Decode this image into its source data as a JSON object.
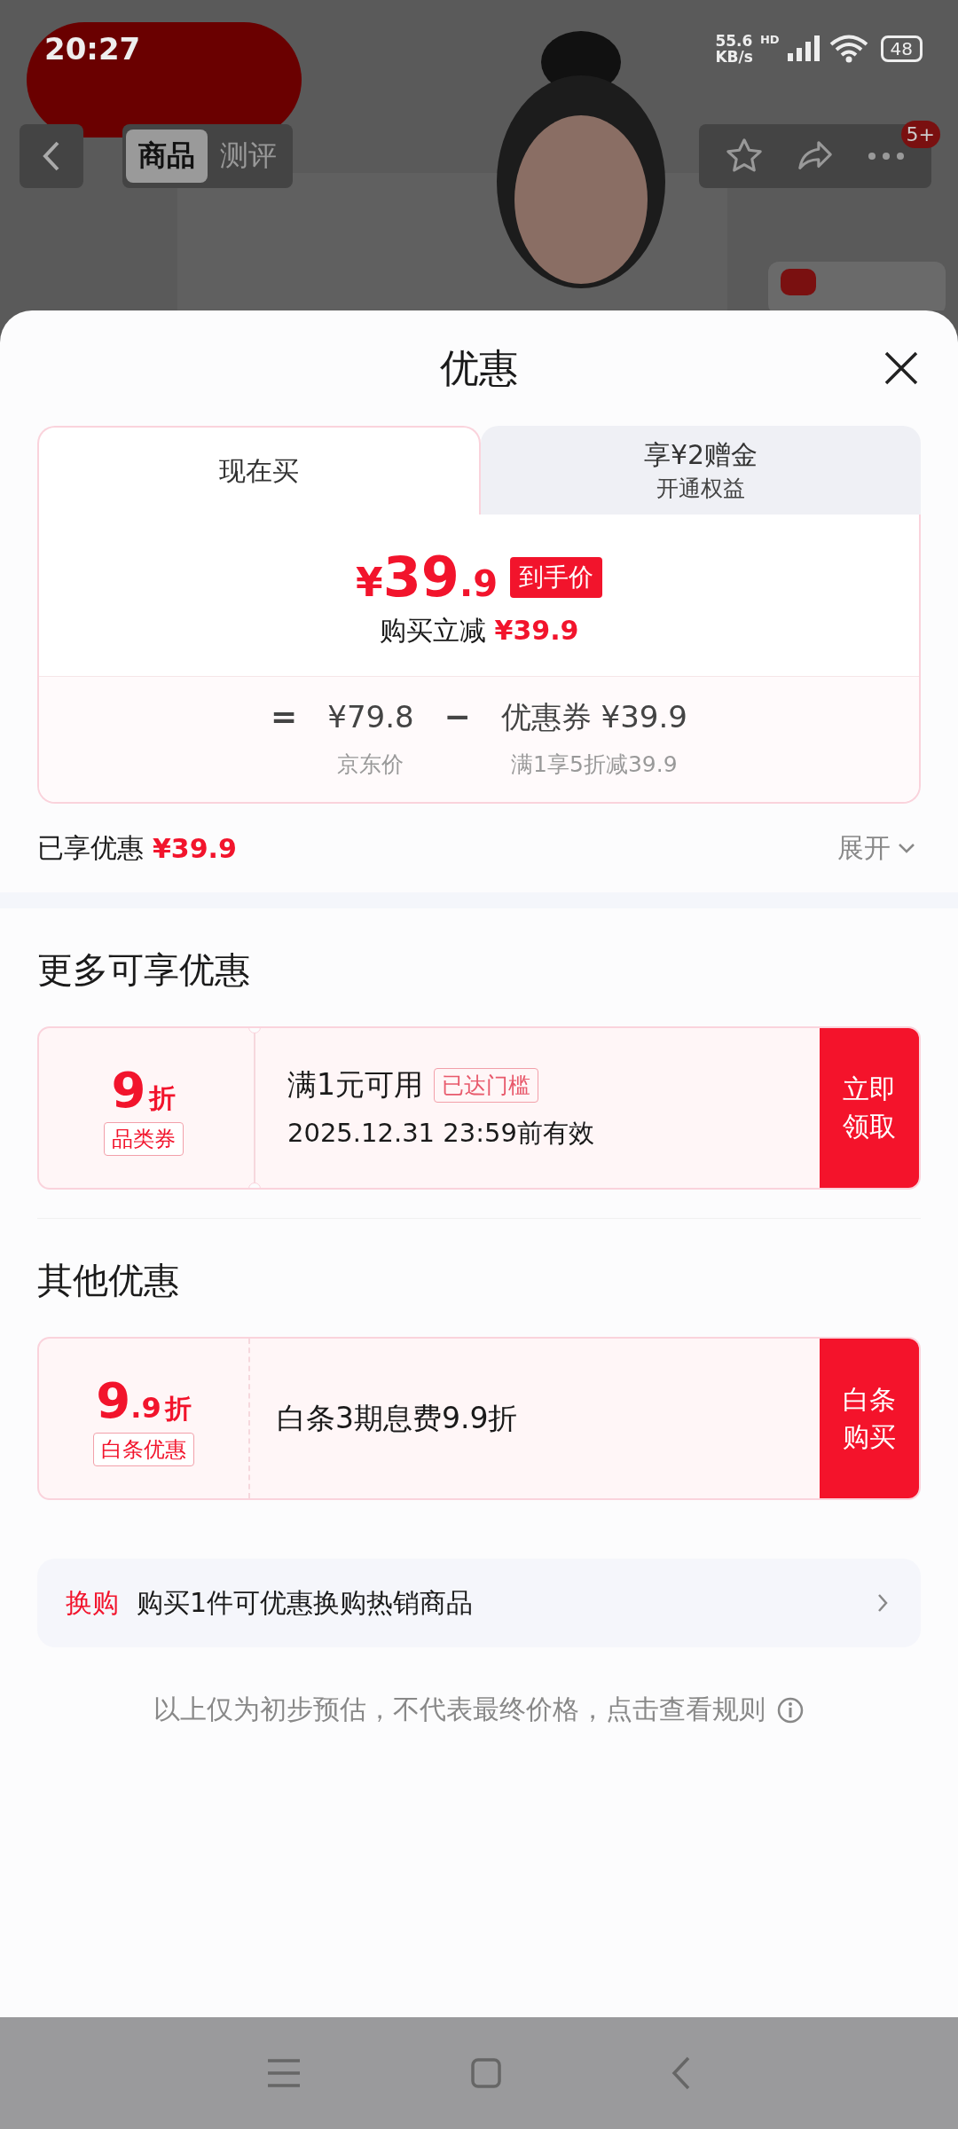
{
  "status_bar": {
    "time": "20:27",
    "net_speed_value": "55.6",
    "net_speed_unit": "KB/s",
    "hd": "HD",
    "battery": "48"
  },
  "product_header": {
    "tabs": [
      {
        "label": "商品",
        "selected": true
      },
      {
        "label": "测评",
        "selected": false
      }
    ],
    "badge": "5+"
  },
  "sheet": {
    "title": "优惠",
    "price_tabs": [
      {
        "label": "现在买",
        "selected": true
      },
      {
        "label": "享¥2赠金",
        "sub": "开通权益",
        "selected": false
      }
    ],
    "final_price": {
      "currency": "¥",
      "integer": "39",
      "decimal": ".9",
      "tag": "到手价"
    },
    "reduction": {
      "label": "购买立减",
      "amount": "¥39.9"
    },
    "formula": [
      {
        "kind": "op",
        "text": "="
      },
      {
        "kind": "term",
        "text": "¥79.8",
        "caption": "京东价"
      },
      {
        "kind": "op",
        "text": "−"
      },
      {
        "kind": "term",
        "text": "优惠券 ¥39.9",
        "caption": "满1享5折减39.9"
      }
    ],
    "enjoyed": {
      "label": "已享优惠",
      "amount": "¥39.9",
      "toggle": "展开"
    },
    "sections": [
      {
        "title": "更多可享优惠",
        "offers": [
          {
            "kind": "coupon",
            "big": "9",
            "unit": "折",
            "tag": "品类券",
            "title": "满1元可用",
            "badge": "已达门槛",
            "subtitle": "2025.12.31 23:59前有效",
            "action": "立即领取"
          }
        ]
      },
      {
        "title": "其他优惠",
        "offers": [
          {
            "kind": "plain",
            "big": "9",
            "small": ".9",
            "unit": "折",
            "tag": "白条优惠",
            "title": "白条3期息费9.9折",
            "action": "白条购买"
          }
        ]
      }
    ],
    "exchange": {
      "label": "换购",
      "text": "购买1件可优惠换购热销商品"
    },
    "disclaimer": "以上仅为初步预估，不代表最终价格，点击查看规则"
  }
}
